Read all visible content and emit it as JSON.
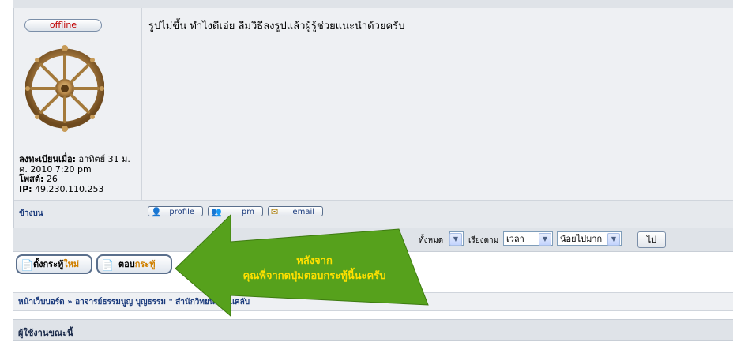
{
  "post": {
    "status": "offline",
    "registered_label": "ลงทะเบียนเมื่อ:",
    "registered_value": "อาทิตย์ 31 ม.",
    "registered_value2": "ค. 2010 7:20 pm",
    "posts_label": "โพสต์:",
    "posts_value": "26",
    "ip_label": "IP:",
    "ip_value": "49.230.110.253",
    "message": "รูปไม่ขึ้น ทำไงดีเอ่ย ลืมวิธีลงรูปแล้วผู้รู้ช่วยแนะนำด้วยครับ",
    "back_to_top": "ข้างบน",
    "buttons": {
      "profile": "profile",
      "pm": "pm",
      "email": "email"
    }
  },
  "sortbar": {
    "show_label": "ทั้งหมด",
    "sort_label": "เรียงตาม",
    "sort_field": "เวลา",
    "sort_order": "น้อยไปมาก",
    "go": "ไป"
  },
  "actions": {
    "new_topic_1": "ตั้งกระทู้",
    "new_topic_2": "ใหม่",
    "reply_1": "ตอบ",
    "reply_2": "กระทู้"
  },
  "breadcrumb": "หน้าเว็บบอร์ด » อาจารย์ธรรมนูญ บุญธรรม \" สำนักวิทยนต์บ้านคลับ",
  "online": {
    "title": "ผู้ใช้งานขณะนี้"
  },
  "annotation": {
    "line1": "หลังจาก",
    "line2": "คุณพี่จากดปุ่มตอบกระทู้นี้นะครับ",
    "color": "#56a11c"
  }
}
